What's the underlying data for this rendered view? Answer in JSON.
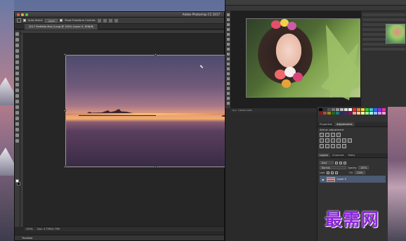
{
  "main_window": {
    "title": "Adobe Photoshop CC 2017",
    "options": {
      "auto_select_label": "Auto-Select:",
      "auto_select_value": "Layer",
      "transform_label": "Show Transform Controls"
    },
    "doc_tab": "2017 Portfolio Max-5.png @ 100% (Layer 0, RGB/8)",
    "status": {
      "zoom": "100%",
      "doc_size": "Doc: 4.79M/4.79M"
    },
    "timeline_label": "Timeline"
  },
  "right_window": {
    "status": "Doc: 3.84M/3.84M"
  },
  "panels": {
    "tabs_adjust": [
      "Properties",
      "Adjustments"
    ],
    "active_adjust_tab": "Adjustments",
    "adjust_title": "Add an adjustment",
    "tabs_layers": [
      "Layers",
      "Channels",
      "Paths"
    ],
    "blend_mode": "Normal",
    "opacity_label": "Opacity:",
    "opacity_value": "100%",
    "lock_label": "Lock:",
    "fill_label": "Fill:",
    "fill_value": "100%",
    "layer_name": "Layer 0"
  },
  "watermark": "最需网",
  "colors": {
    "accent_layer": "#4c5a72",
    "watermark": "#8a24d8"
  }
}
